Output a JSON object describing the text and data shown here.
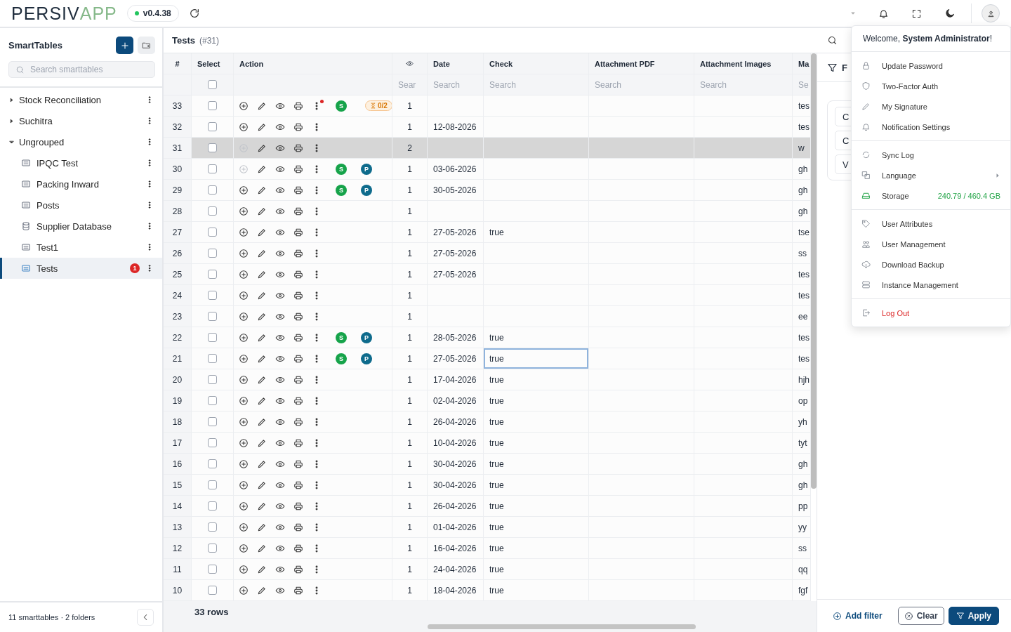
{
  "topbar": {
    "logo": {
      "dark": "PERSIV",
      "light": "APP"
    },
    "version": "v0.4.38"
  },
  "sidebar": {
    "title": "SmartTables",
    "search": {
      "placeholder": "Search smarttables"
    },
    "tree": [
      {
        "label": "Stock Reconciliation",
        "kind": "folder",
        "expanded": false,
        "selected": false
      },
      {
        "label": "Suchitra",
        "kind": "folder",
        "expanded": false,
        "selected": false
      },
      {
        "label": "Ungrouped",
        "kind": "folder",
        "expanded": true,
        "selected": false,
        "children": [
          {
            "label": "IPQC Test",
            "kind": "table",
            "selected": false
          },
          {
            "label": "Packing Inward",
            "kind": "table",
            "selected": false
          },
          {
            "label": "Posts",
            "kind": "table",
            "selected": false
          },
          {
            "label": "Supplier Database",
            "kind": "database",
            "selected": false
          },
          {
            "label": "Test1",
            "kind": "table",
            "selected": false
          },
          {
            "label": "Tests",
            "kind": "table",
            "selected": true,
            "badge": "1"
          }
        ]
      }
    ],
    "footer": "11 smarttables · 2 folders"
  },
  "table": {
    "title": "Tests",
    "subtitle": "(#31)",
    "select_all_checked": false,
    "columns": [
      {
        "kind": "index",
        "label": "#"
      },
      {
        "kind": "select",
        "label": "Select"
      },
      {
        "kind": "action",
        "label": "Action"
      },
      {
        "kind": "eye",
        "placeholder": "Sear"
      },
      {
        "kind": "text",
        "label": "Date",
        "placeholder": "Search"
      },
      {
        "kind": "text",
        "label": "Check",
        "placeholder": "Search"
      },
      {
        "kind": "text",
        "label": "Attachment PDF",
        "placeholder": "Search"
      },
      {
        "kind": "text",
        "label": "Attachment Images",
        "placeholder": "Search"
      },
      {
        "kind": "text",
        "label": "Ma",
        "placeholder": "Se"
      }
    ],
    "rows": [
      {
        "number": "33",
        "checked": false,
        "selected": false,
        "add_disabled": false,
        "menu_dot": true,
        "badges": [
          {
            "label": "S",
            "color": "#16a34a"
          }
        ],
        "pending": "0/2",
        "value": "1",
        "column_9": "tes",
        "check_cell_focused": false
      },
      {
        "number": "32",
        "checked": false,
        "selected": false,
        "add_disabled": false,
        "menu_dot": false,
        "value": "1",
        "date": "12-08-2026",
        "column_9": "tes",
        "check_cell_focused": false
      },
      {
        "number": "31",
        "checked": false,
        "selected": true,
        "add_disabled": true,
        "menu_dot": false,
        "value": "2",
        "column_9": "w",
        "check_cell_focused": false
      },
      {
        "number": "30",
        "checked": false,
        "selected": false,
        "add_disabled": true,
        "menu_dot": false,
        "badges": [
          {
            "label": "S",
            "color": "#16a34a"
          },
          {
            "label": "P",
            "color": "#0e6b8c"
          }
        ],
        "value": "1",
        "date": "03-06-2026",
        "column_9": "gh",
        "check_cell_focused": false
      },
      {
        "number": "29",
        "checked": false,
        "selected": false,
        "add_disabled": false,
        "menu_dot": false,
        "badges": [
          {
            "label": "S",
            "color": "#16a34a"
          },
          {
            "label": "P",
            "color": "#0e6b8c"
          }
        ],
        "value": "1",
        "date": "30-05-2026",
        "column_9": "gh",
        "check_cell_focused": false
      },
      {
        "number": "28",
        "checked": false,
        "selected": false,
        "add_disabled": false,
        "menu_dot": false,
        "value": "1",
        "column_9": "gh",
        "check_cell_focused": false
      },
      {
        "number": "27",
        "checked": false,
        "selected": false,
        "add_disabled": false,
        "menu_dot": false,
        "value": "1",
        "date": "27-05-2026",
        "check": "true",
        "column_9": "tse",
        "check_cell_focused": false
      },
      {
        "number": "26",
        "checked": false,
        "selected": false,
        "add_disabled": false,
        "menu_dot": false,
        "value": "1",
        "date": "27-05-2026",
        "column_9": "ss",
        "check_cell_focused": false
      },
      {
        "number": "25",
        "checked": false,
        "selected": false,
        "add_disabled": false,
        "menu_dot": false,
        "value": "1",
        "date": "27-05-2026",
        "column_9": "tes",
        "check_cell_focused": false
      },
      {
        "number": "24",
        "checked": false,
        "selected": false,
        "add_disabled": false,
        "menu_dot": false,
        "value": "1",
        "column_9": "tes",
        "check_cell_focused": false
      },
      {
        "number": "23",
        "checked": false,
        "selected": false,
        "add_disabled": false,
        "menu_dot": false,
        "value": "1",
        "column_9": "ee",
        "check_cell_focused": false
      },
      {
        "number": "22",
        "checked": false,
        "selected": false,
        "add_disabled": false,
        "menu_dot": false,
        "badges": [
          {
            "label": "S",
            "color": "#16a34a"
          },
          {
            "label": "P",
            "color": "#0e6b8c"
          }
        ],
        "value": "1",
        "date": "28-05-2026",
        "check": "true",
        "column_9": "tes",
        "check_cell_focused": false
      },
      {
        "number": "21",
        "checked": false,
        "selected": false,
        "add_disabled": false,
        "menu_dot": false,
        "badges": [
          {
            "label": "S",
            "color": "#16a34a"
          },
          {
            "label": "P",
            "color": "#0e6b8c"
          }
        ],
        "value": "1",
        "date": "27-05-2026",
        "check": "true",
        "column_9": "tes",
        "check_cell_focused": true
      },
      {
        "number": "20",
        "checked": false,
        "selected": false,
        "add_disabled": false,
        "menu_dot": false,
        "value": "1",
        "date": "17-04-2026",
        "check": "true",
        "column_9": "hjh",
        "check_cell_focused": false
      },
      {
        "number": "19",
        "checked": false,
        "selected": false,
        "add_disabled": false,
        "menu_dot": false,
        "value": "1",
        "date": "02-04-2026",
        "check": "true",
        "column_9": "op",
        "check_cell_focused": false
      },
      {
        "number": "18",
        "checked": false,
        "selected": false,
        "add_disabled": false,
        "menu_dot": false,
        "value": "1",
        "date": "26-04-2026",
        "check": "true",
        "column_9": "yh",
        "check_cell_focused": false
      },
      {
        "number": "17",
        "checked": false,
        "selected": false,
        "add_disabled": false,
        "menu_dot": false,
        "value": "1",
        "date": "10-04-2026",
        "check": "true",
        "column_9": "tyt",
        "check_cell_focused": false
      },
      {
        "number": "16",
        "checked": false,
        "selected": false,
        "add_disabled": false,
        "menu_dot": false,
        "value": "1",
        "date": "30-04-2026",
        "check": "true",
        "column_9": "gh",
        "check_cell_focused": false
      },
      {
        "number": "15",
        "checked": false,
        "selected": false,
        "add_disabled": false,
        "menu_dot": false,
        "value": "1",
        "date": "30-04-2026",
        "check": "true",
        "column_9": "gh",
        "check_cell_focused": false
      },
      {
        "number": "14",
        "checked": false,
        "selected": false,
        "add_disabled": false,
        "menu_dot": false,
        "value": "1",
        "date": "26-04-2026",
        "check": "true",
        "column_9": "pp",
        "check_cell_focused": false
      },
      {
        "number": "13",
        "checked": false,
        "selected": false,
        "add_disabled": false,
        "menu_dot": false,
        "value": "1",
        "date": "01-04-2026",
        "check": "true",
        "column_9": "yy",
        "check_cell_focused": false
      },
      {
        "number": "12",
        "checked": false,
        "selected": false,
        "add_disabled": false,
        "menu_dot": false,
        "value": "1",
        "date": "16-04-2026",
        "check": "true",
        "column_9": "ss",
        "check_cell_focused": false
      },
      {
        "number": "11",
        "checked": false,
        "selected": false,
        "add_disabled": false,
        "menu_dot": false,
        "value": "1",
        "date": "24-04-2026",
        "check": "true",
        "column_9": "qq",
        "check_cell_focused": false
      },
      {
        "number": "10",
        "checked": false,
        "selected": false,
        "add_disabled": false,
        "menu_dot": false,
        "value": "1",
        "date": "18-04-2026",
        "check": "true",
        "column_9": "fgf",
        "check_cell_focused": false
      }
    ],
    "footer": "33 rows"
  },
  "filter_panel": {
    "title": "F",
    "fields": [
      "C",
      "C",
      "V"
    ],
    "buttons": [
      {
        "kind": "link",
        "label": "Add filter"
      },
      {
        "kind": "outline",
        "label": "Clear"
      },
      {
        "kind": "primary",
        "label": "Apply"
      }
    ]
  },
  "user_menu": {
    "welcome": "Welcome, **System Administrator**!",
    "sections": [
      [
        {
          "label": "Update Password",
          "kind": "item"
        },
        {
          "label": "Two-Factor Auth",
          "kind": "item"
        },
        {
          "label": "My Signature",
          "kind": "item"
        },
        {
          "label": "Notification Settings",
          "kind": "item"
        }
      ],
      [
        {
          "label": "Sync Log",
          "kind": "item"
        },
        {
          "label": "Language",
          "kind": "submenu"
        },
        {
          "label": "Storage",
          "kind": "storage",
          "value": "240.79 / 460.4 GB"
        }
      ],
      [
        {
          "label": "User Attributes",
          "kind": "item"
        },
        {
          "label": "User Management",
          "kind": "item"
        },
        {
          "label": "Download Backup",
          "kind": "item"
        },
        {
          "label": "Instance Management",
          "kind": "item"
        }
      ],
      [
        {
          "label": "Log Out",
          "kind": "danger"
        }
      ]
    ]
  }
}
